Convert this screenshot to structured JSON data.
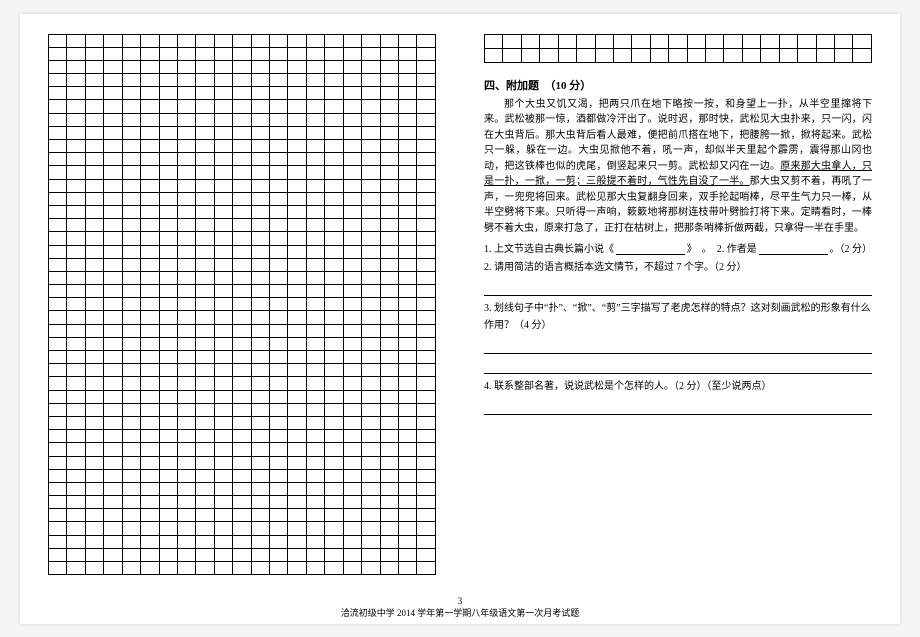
{
  "section4": {
    "heading": "四、附加题　（10 分）",
    "passage_html": "那个大虫又饥又渴，把两只爪在地下略按一按，和身望上一扑，从半空里撺将下来。武松被那一惊，酒都做冷汗出了。说时迟，那时快，武松见大虫扑来，只一闪，闪在大虫背后。那大虫背后看人最难，便把前爪搭在地下，把腰胯一掀，掀将起来。武松只一躲，躲在一边。大虫见掀他不着，吼一声，却似半天里起个霹雳，震得那山冈也动，把这铁棒也似的虎尾，倒竖起来只一剪。武松却又闪在一边。<u>原来那大虫拿人，只是一扑，一掀，一剪；三般提不着时，气性先自没了一半。</u>那大虫又剪不着，再吼了一声，一兜兜将回来。武松见那大虫复翻身回来，双手抡起哨棒，尽平生气力只一棒，从半空劈将下来。只听得一声响，簌簌地将那树连枝带叶劈脸打将下来。定睛看时，一棒劈不着大虫，原来打急了，正打在枯树上，把那条哨棒折做两截，只拿得一半在手里。",
    "q1_prefix": "1. 上文节选自古典长篇小说《",
    "q1_mid": "》　。　2. 作者是",
    "q1_suffix": "。（2 分）",
    "q2": "2. 请用简洁的语言概括本选文情节，不超过 7  个字。（2 分）",
    "q3": "3. 划线句子中“扑”、“掀”、“剪”三字描写了老虎怎样的特点？这对刻画武松的形象有什么作用？（4 分）",
    "q4": "4. 联系整部名著，说说武松是个怎样的人。（2 分）（至少说两点）"
  },
  "footer": {
    "page_no": "3",
    "line": "洽流初级中学 2014 学年第一学期八年级语文第一次月考试题"
  },
  "layout": {
    "left_grid_rows": 41,
    "right_grid_rows": 2,
    "grid_cols": 21
  }
}
